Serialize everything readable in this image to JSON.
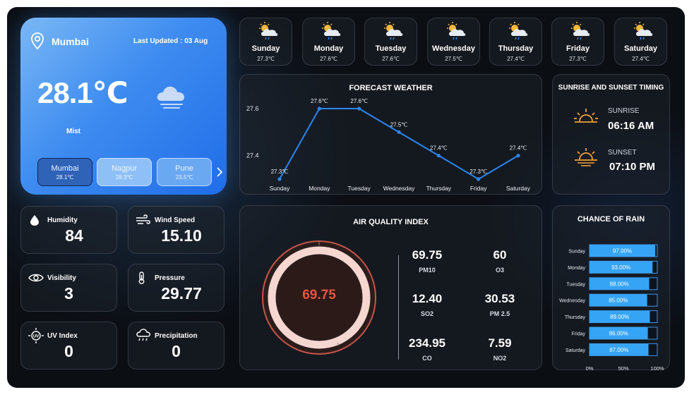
{
  "current": {
    "city": "Mumbai",
    "last_updated": "Last Updated : 03 Aug",
    "temperature": "28.1℃",
    "condition": "Mist",
    "icon": "cloud-mist-icon"
  },
  "cities": [
    {
      "name": "Mumbai",
      "temp": "28.1℃"
    },
    {
      "name": "Nagpur",
      "temp": "28.3℃"
    },
    {
      "name": "Pune",
      "temp": "23.5℃"
    }
  ],
  "days": [
    {
      "name": "Sunday",
      "temp": "27.3℃",
      "icon": "sun-cloud-rain-icon"
    },
    {
      "name": "Monday",
      "temp": "27.6℃",
      "icon": "sun-cloud-rain-icon"
    },
    {
      "name": "Tuesday",
      "temp": "27.6℃",
      "icon": "sun-cloud-rain-icon"
    },
    {
      "name": "Wednesday",
      "temp": "27.5℃",
      "icon": "sun-cloud-rain-icon"
    },
    {
      "name": "Thursday",
      "temp": "27.4℃",
      "icon": "sun-cloud-rain-icon"
    },
    {
      "name": "Friday",
      "temp": "27.3℃",
      "icon": "sun-cloud-rain-icon"
    },
    {
      "name": "Saturday",
      "temp": "27.4℃",
      "icon": "sun-cloud-rain-icon"
    }
  ],
  "forecast": {
    "title": "FORECAST WEATHER"
  },
  "sun": {
    "title": "SUNRISE AND SUNSET TIMING",
    "sunrise_label": "SUNRISE",
    "sunrise_time": "06:16 AM",
    "sunset_label": "SUNSET",
    "sunset_time": "07:10 PM"
  },
  "metrics": {
    "humidity": {
      "label": "Humidity",
      "value": "84"
    },
    "wind": {
      "label": "Wind Speed",
      "value": "15.10"
    },
    "visibility": {
      "label": "Visibility",
      "value": "3"
    },
    "pressure": {
      "label": "Pressure",
      "value": "29.77"
    },
    "uv": {
      "label": "UV Index",
      "value": "0"
    },
    "precip": {
      "label": "Precipitation",
      "value": "0"
    }
  },
  "aqi": {
    "title": "AIR QUALITY INDEX",
    "value": "69.75",
    "gauge_fraction": 1.0,
    "pollutants": [
      {
        "key": "PM10",
        "value": "69.75"
      },
      {
        "key": "O3",
        "value": "60"
      },
      {
        "key": "SO2",
        "value": "12.40"
      },
      {
        "key": "PM 2.5",
        "value": "30.53"
      },
      {
        "key": "CO",
        "value": "234.95"
      },
      {
        "key": "NO2",
        "value": "7.59"
      }
    ]
  },
  "rain": {
    "title": "CHANCE OF RAIN"
  },
  "colors": {
    "accent": "#2f8cf0",
    "line": "#2b86f0",
    "bar": "#36a4f5",
    "sun": "#f2a23a",
    "aqi_text": "#e9543f"
  },
  "chart_data": [
    {
      "type": "line",
      "title": "FORECAST WEATHER",
      "categories": [
        "Sunday",
        "Monday",
        "Tuesday",
        "Wednesday",
        "Thursday",
        "Friday",
        "Saturday"
      ],
      "values": [
        27.3,
        27.6,
        27.6,
        27.5,
        27.4,
        27.3,
        27.4
      ],
      "data_labels": [
        "27.3℃",
        "27.6℃",
        "27.6℃",
        "27.5℃",
        "27.4℃",
        "27.3℃",
        "27.4℃"
      ],
      "yticks": [
        "27.6",
        "27.4"
      ],
      "ylim": [
        27.3,
        27.6
      ],
      "grid": false
    },
    {
      "type": "bar",
      "orientation": "horizontal",
      "title": "CHANCE OF RAIN",
      "categories": [
        "Sunday",
        "Monday",
        "Tuesday",
        "Wednesday",
        "Thursday",
        "Friday",
        "Saturday"
      ],
      "values": [
        97.0,
        93.0,
        88.0,
        85.0,
        89.0,
        86.0,
        87.0
      ],
      "data_labels": [
        "97.00%",
        "93.00%",
        "88.00%",
        "85.00%",
        "89.00%",
        "86.00%",
        "87.00%"
      ],
      "xticks": [
        "0%",
        "50%",
        "100%"
      ],
      "xlim": [
        0,
        100
      ],
      "grid": false
    }
  ]
}
